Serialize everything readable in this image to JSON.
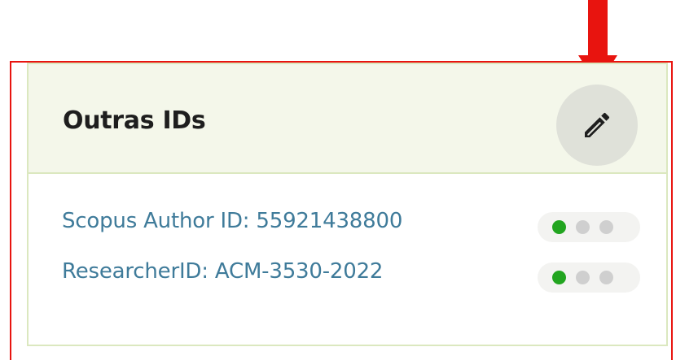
{
  "card": {
    "title": "Outras IDs",
    "edit_icon": "pencil-icon"
  },
  "identifiers": [
    {
      "text": "Scopus Author ID: 55921438800",
      "visibility": [
        "public",
        "limited",
        "private"
      ],
      "active_level": "public"
    },
    {
      "text": "ResearcherID: ACM-3530-2022",
      "visibility": [
        "public",
        "limited",
        "private"
      ],
      "active_level": "public"
    }
  ],
  "colors": {
    "annotation": "#e8140f",
    "header_bg": "#f4f7ea",
    "border": "#dbe8bf",
    "link": "#3f7b9a",
    "active_dot": "#22a520",
    "inactive_dot": "#cfcfcf"
  },
  "annotation": {
    "arrow_icon": "arrow-down-icon"
  }
}
